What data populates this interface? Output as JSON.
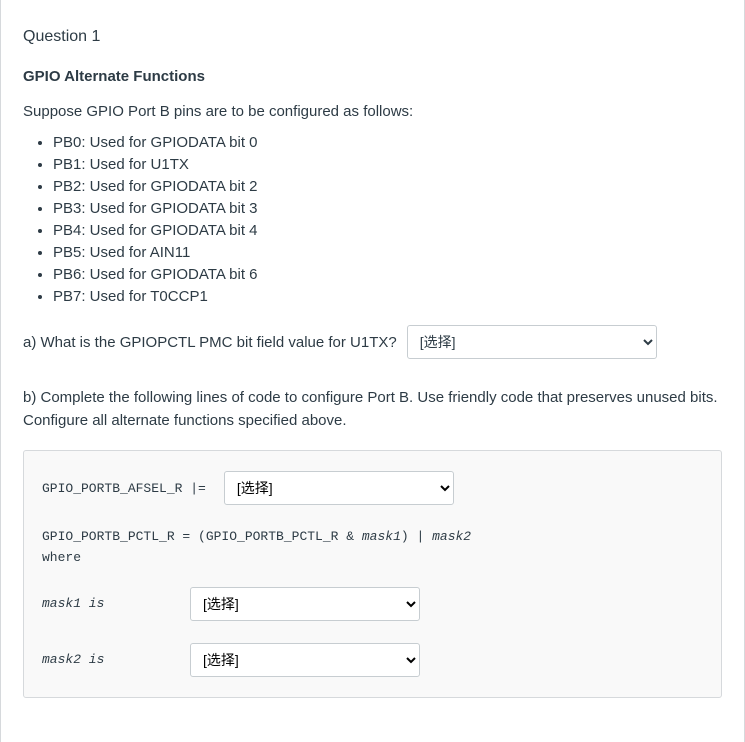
{
  "question_number": "Question 1",
  "section_title": "GPIO Alternate Functions",
  "intro_text": "Suppose GPIO Port B pins are to be configured as follows:",
  "pins": [
    "PB0: Used for GPIODATA bit 0",
    "PB1: Used for U1TX",
    "PB2: Used for GPIODATA bit 2",
    "PB3: Used for GPIODATA bit 3",
    "PB4: Used for GPIODATA bit 4",
    "PB5: Used for AIN11",
    "PB6: Used for GPIODATA bit 6",
    "PB7: Used for T0CCP1"
  ],
  "part_a": {
    "prompt": "a) What is the GPIOPCTL PMC bit field value for U1TX?",
    "placeholder": "[选择]"
  },
  "part_b": {
    "prompt": "b) Complete the following lines of code to configure Port B. Use friendly code that preserves unused bits. Configure all alternate functions specified above."
  },
  "code": {
    "afsel_lhs": "GPIO_PORTB_AFSEL_R |=",
    "afsel_placeholder": "[选择]",
    "pctl_line_prefix": "GPIO_PORTB_PCTL_R = (GPIO_PORTB_PCTL_R & ",
    "pctl_mask1": "mask1",
    "pctl_middle": ") | ",
    "pctl_mask2": "mask2",
    "where": "where",
    "mask1_label": "mask1 is",
    "mask1_placeholder": "[选择]",
    "mask2_label": "mask2 is",
    "mask2_placeholder": "[选择]"
  }
}
